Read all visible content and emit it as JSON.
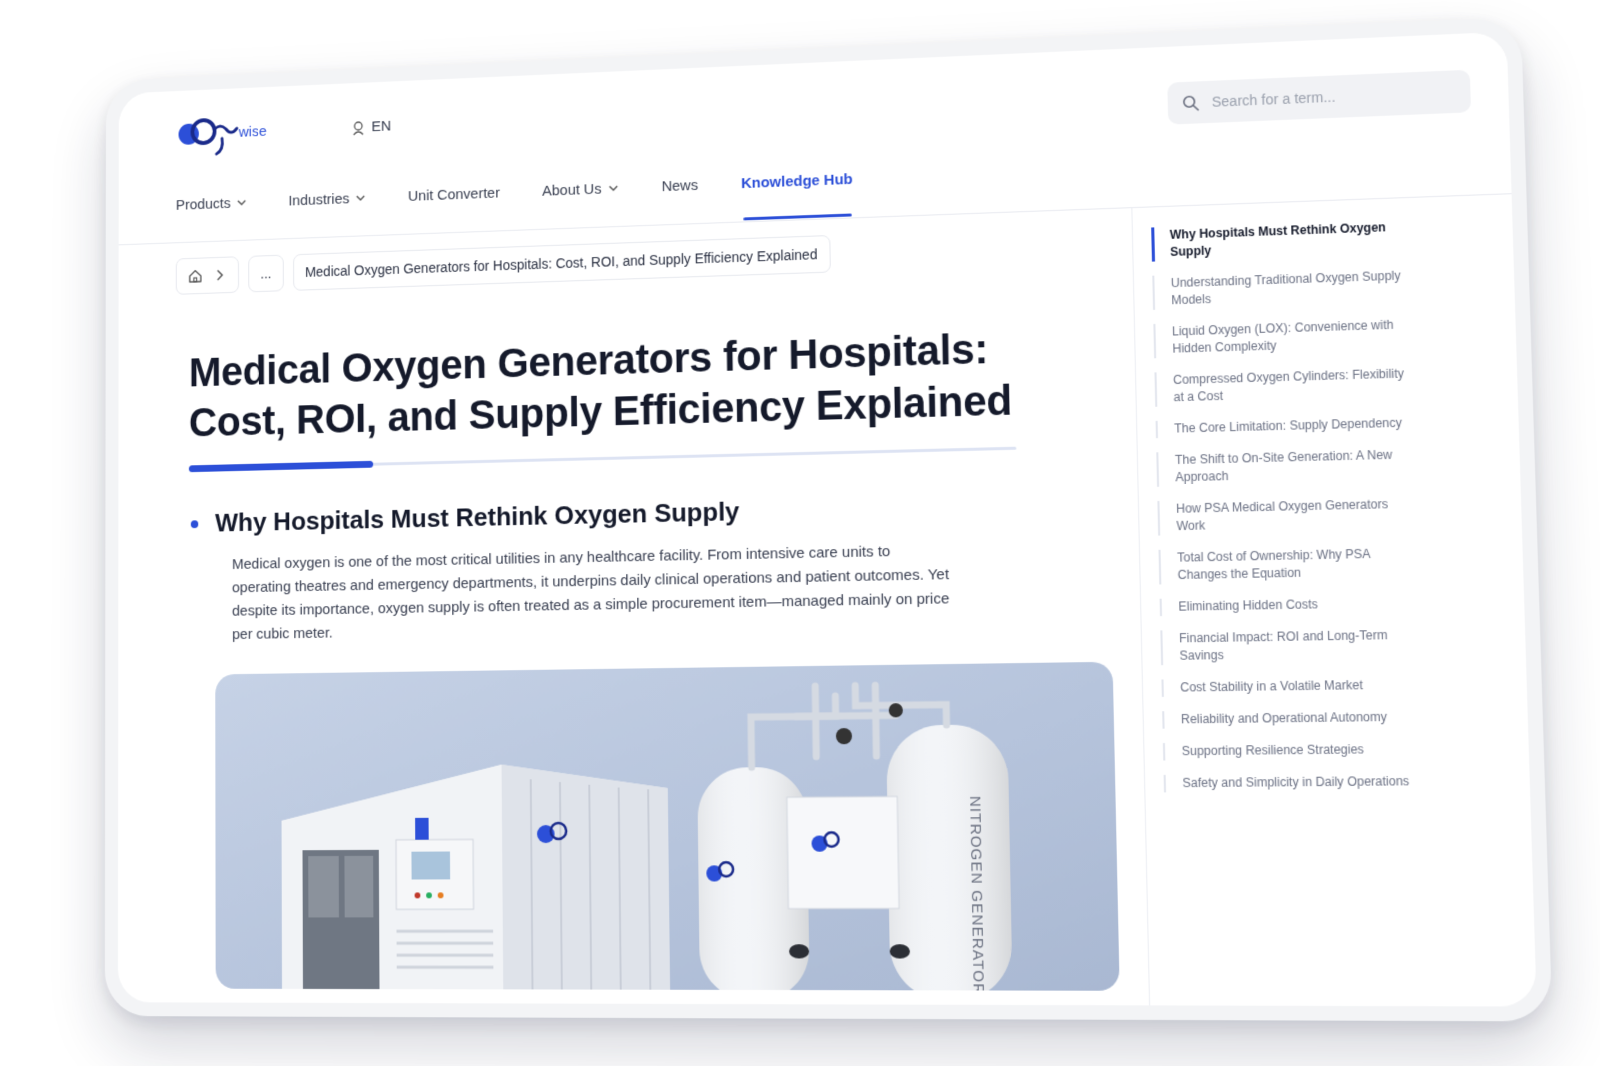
{
  "brand": {
    "name": "Oxywise",
    "logo_text": "wise",
    "accent": "#2c4fd8",
    "dark_blue": "#1a2a8a"
  },
  "header": {
    "lang": {
      "icon": "globe-icon",
      "label": "EN"
    },
    "search": {
      "icon": "search-icon",
      "placeholder": "Search for a term..."
    }
  },
  "nav": {
    "items": [
      {
        "label": "Products",
        "dropdown": true
      },
      {
        "label": "Industries",
        "dropdown": true
      },
      {
        "label": "Unit Converter",
        "dropdown": false
      },
      {
        "label": "About Us",
        "dropdown": true
      },
      {
        "label": "News",
        "dropdown": false
      },
      {
        "label": "Knowledge Hub",
        "dropdown": false,
        "active": true
      }
    ]
  },
  "breadcrumb": {
    "home_icon": "home-icon",
    "separator_icon": "chevron-right-icon",
    "ellipsis": "...",
    "current": "Medical Oxygen Generators for Hospitals: Cost, ROI, and Supply Efficiency Explained"
  },
  "article": {
    "title_line1": "Medical Oxygen Generators for Hospitals:",
    "title_line2": "Cost, ROI, and Supply Efficiency Explained",
    "section_title": "Why Hospitals Must Rethink Oxygen Supply",
    "paragraph": "Medical oxygen is one of the most critical utilities in any healthcare facility. From intensive care units to operating theatres and emergency departments, it underpins daily clinical operations and patient outcomes. Yet despite its importance, oxygen supply is often treated as a simple procurement item—managed mainly on price per cubic meter.",
    "hero_image_text": "NITROGEN GENERATOR"
  },
  "toc": {
    "items": [
      {
        "label": "Why Hospitals Must Rethink Oxygen Supply",
        "active": true
      },
      {
        "label": "Understanding Traditional Oxygen Supply Models"
      },
      {
        "label": "Liquid Oxygen (LOX): Convenience with Hidden Complexity"
      },
      {
        "label": "Compressed Oxygen Cylinders: Flexibility at a Cost"
      },
      {
        "label": "The Core Limitation: Supply Dependency"
      },
      {
        "label": "The Shift to On-Site Generation: A New Approach"
      },
      {
        "label": "How PSA Medical Oxygen Generators Work"
      },
      {
        "label": "Total Cost of Ownership: Why PSA Changes the Equation"
      },
      {
        "label": "Eliminating Hidden Costs"
      },
      {
        "label": "Financial Impact: ROI and Long-Term Savings"
      },
      {
        "label": "Cost Stability in a Volatile Market"
      },
      {
        "label": "Reliability and Operational Autonomy"
      },
      {
        "label": "Supporting Resilience Strategies"
      },
      {
        "label": "Safety and Simplicity in Daily Operations"
      }
    ]
  }
}
